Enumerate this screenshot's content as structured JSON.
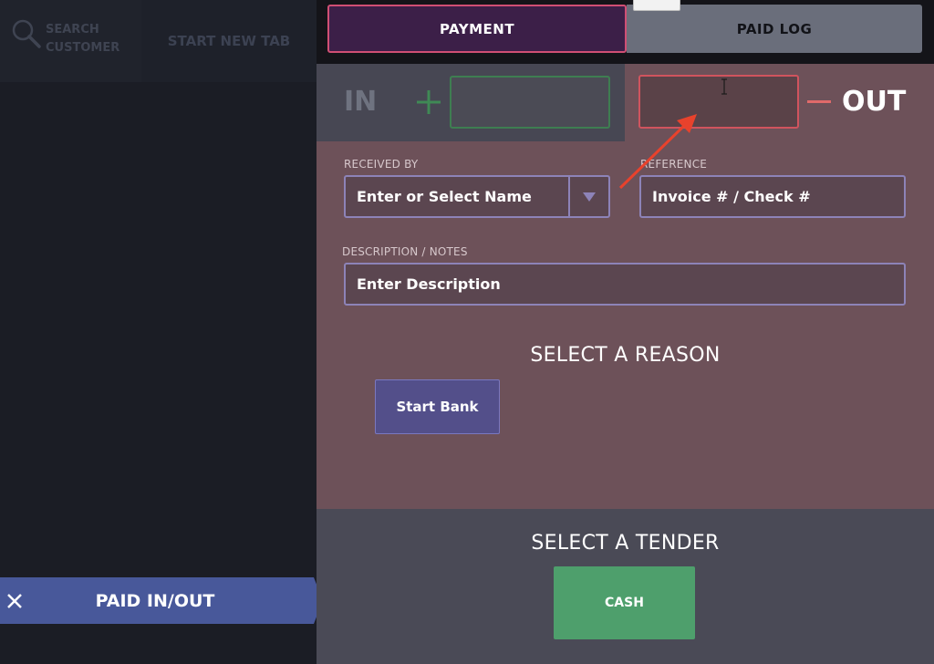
{
  "colors": {
    "payment_tab_bg": "#3c1f48",
    "payment_tab_border": "#d04f74",
    "in_border": "#3e7e51",
    "out_border": "#d0545e",
    "main_bg": "#6d5159",
    "start_bank_bg": "#534f8a",
    "cash_bg": "#4e9f6c",
    "paid_tab_bg": "#48589a",
    "annotation_arrow": "#e8422c"
  },
  "left": {
    "search_label": "SEARCH CUSTOMER",
    "start_new_tab": "START NEW TAB",
    "paid_tab_label": "PAID IN/OUT",
    "icons": {
      "search": "search-icon",
      "close": "close-icon"
    }
  },
  "tabs": {
    "payment": "PAYMENT",
    "paid_log": "PAID LOG"
  },
  "amount": {
    "in_label": "IN",
    "out_label": "OUT",
    "in_value": "",
    "out_value": ""
  },
  "form": {
    "received_by_label": "RECEIVED BY",
    "received_by_value": "Enter or Select Name",
    "reference_label": "REFERENCE",
    "reference_placeholder": "Invoice # / Check #",
    "description_label": "DESCRIPTION / NOTES",
    "description_placeholder": "Enter Description"
  },
  "reason": {
    "title": "SELECT A REASON",
    "buttons": [
      "Start Bank"
    ]
  },
  "tender": {
    "title": "SELECT A TENDER",
    "buttons": [
      "CASH"
    ]
  }
}
